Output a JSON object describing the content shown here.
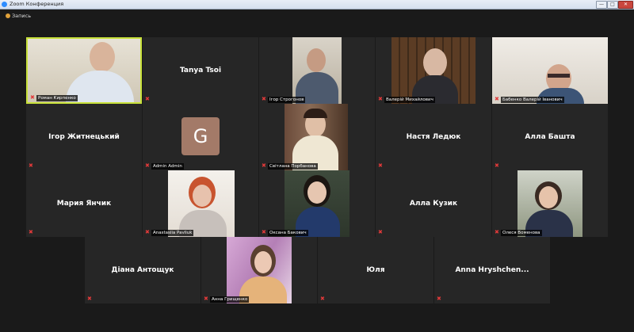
{
  "window": {
    "title": "Zoom Конференция",
    "min": "—",
    "max": "□",
    "close": "✕"
  },
  "infobar": {
    "label": "Запись"
  },
  "colors": {
    "active_border": "#c8e13a",
    "muted_mic": "#e23a3a",
    "tile_bg": "#262626",
    "avatar_g": "#a37a68"
  },
  "participants": {
    "p0": {
      "label": "Роман Кирпенко"
    },
    "p1": {
      "label": "Tanya Tsoi"
    },
    "p2": {
      "label": "Ігор Строгонов"
    },
    "p3": {
      "label": "Валерій Михайлович"
    },
    "p4": {
      "label": "Бабенко Валерій Іванович"
    },
    "p5": {
      "label": "Ігор Житнецький"
    },
    "p6": {
      "label": "Admin Admin",
      "initial": "G"
    },
    "p7": {
      "label": "Світлана Порбанова"
    },
    "p8": {
      "label": "Настя Ледюк"
    },
    "p9": {
      "label": "Алла Башта"
    },
    "p10": {
      "label": "Мария Янчик"
    },
    "p11": {
      "label": "Anastasiia Pavliuk"
    },
    "p12": {
      "label": "Оксана Бакович"
    },
    "p13": {
      "label": "Алла Кузик"
    },
    "p14": {
      "label": "Олеся Воменова"
    },
    "p15": {
      "label": "Діана Антощук"
    },
    "p16": {
      "label": "Анна Грищенко"
    },
    "p17": {
      "label": "Юля"
    },
    "p18": {
      "label": "Anna Hryshchen..."
    }
  }
}
